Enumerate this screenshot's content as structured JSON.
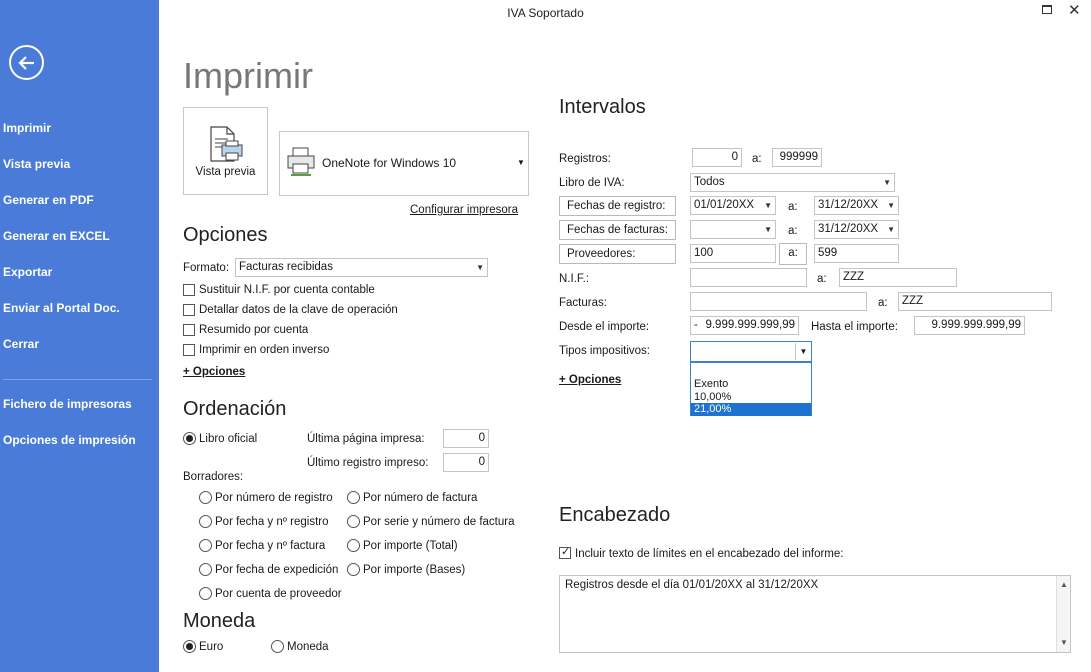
{
  "window": {
    "title": "IVA Soportado"
  },
  "sidebar": {
    "items": [
      "Imprimir",
      "Vista previa",
      "Generar en PDF",
      "Generar en EXCEL",
      "Exportar",
      "Enviar al Portal Doc.",
      "Cerrar"
    ],
    "items2": [
      "Fichero de impresoras",
      "Opciones de impresión"
    ]
  },
  "page": {
    "title": "Imprimir"
  },
  "preview": {
    "label": "Vista previa"
  },
  "printer": {
    "name": "OneNote for Windows 10",
    "configure": "Configurar impresora"
  },
  "opciones": {
    "title": "Opciones",
    "format_label": "Formato:",
    "format_value": "Facturas recibidas",
    "checks": [
      {
        "label": "Sustituir N.I.F. por cuenta contable",
        "checked": false
      },
      {
        "label": "Detallar datos de la clave de operación",
        "checked": false
      },
      {
        "label": "Resumido por cuenta",
        "checked": false
      },
      {
        "label": "Imprimir en orden inverso",
        "checked": false
      }
    ],
    "more": "+ Opciones"
  },
  "ordenacion": {
    "title": "Ordenación",
    "libro": "Libro oficial",
    "ultima_pagina_label": "Última página impresa:",
    "ultima_pagina_value": "0",
    "ultimo_registro_label": "Último registro impreso:",
    "ultimo_registro_value": "0",
    "borradores": "Borradores:",
    "options": [
      "Por número de registro",
      "Por número de factura",
      "Por fecha y nº registro",
      "Por serie y número de factura",
      "Por fecha y nº factura",
      "Por importe (Total)",
      "Por fecha de expedición",
      "Por importe (Bases)",
      "Por cuenta de proveedor"
    ]
  },
  "moneda": {
    "title": "Moneda",
    "euro": "Euro",
    "moneda": "Moneda"
  },
  "intervalos": {
    "title": "Intervalos",
    "registros_label": "Registros:",
    "registros_from": "0",
    "a": "a:",
    "registros_to": "999999",
    "libro_label": "Libro de IVA:",
    "libro_value": "Todos",
    "fechas_registro_label": "Fechas de registro:",
    "fechas_registro_from": "01/01/20XX",
    "fechas_registro_to": "31/12/20XX",
    "fechas_facturas_label": "Fechas de facturas:",
    "fechas_facturas_from": "",
    "fechas_facturas_to": "31/12/20XX",
    "proveedores_label": "Proveedores:",
    "proveedores_from": "100",
    "proveedores_to": "599",
    "nif_label": "N.I.F.:",
    "nif_from": "",
    "nif_to": "ZZZ",
    "facturas_label": "Facturas:",
    "facturas_from": "",
    "facturas_to": "ZZZ",
    "desde_label": "Desde el importe:",
    "desde_sign": "-",
    "desde_value": "9.999.999.999,99",
    "hasta_label": "Hasta el importe:",
    "hasta_value": "9.999.999.999,99",
    "tipos_label": "Tipos impositivos:",
    "tipos_value": "",
    "tipos_options": [
      "Exento",
      "10,00%",
      "21,00%"
    ],
    "tipos_selected": "21,00%",
    "more": "+ Opciones"
  },
  "encabezado": {
    "title": "Encabezado",
    "include_label": "Incluir texto de límites en el encabezado del informe:",
    "include_checked": true,
    "text": "Registros desde el día 01/01/20XX al 31/12/20XX"
  }
}
